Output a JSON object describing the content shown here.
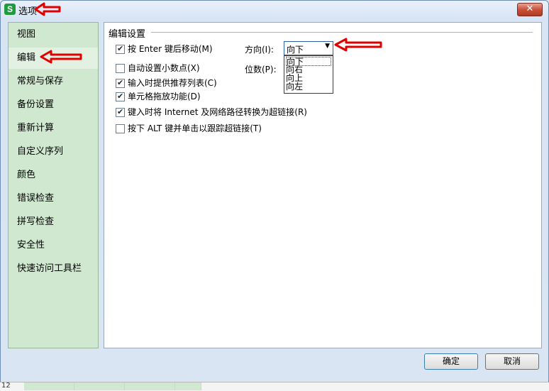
{
  "window": {
    "title": "选项",
    "app_icon_text": "S",
    "close_symbol": "✕"
  },
  "sidebar": {
    "items": [
      {
        "label": "视图"
      },
      {
        "label": "编辑"
      },
      {
        "label": "常规与保存"
      },
      {
        "label": "备份设置"
      },
      {
        "label": "重新计算"
      },
      {
        "label": "自定义序列"
      },
      {
        "label": "颜色"
      },
      {
        "label": "错误检查"
      },
      {
        "label": "拼写检查"
      },
      {
        "label": "安全性"
      },
      {
        "label": "快速访问工具栏"
      }
    ],
    "selected_index": 1
  },
  "edit": {
    "group_title": "编辑设置",
    "options": [
      {
        "label": "按 Enter 键后移动(M)",
        "checked": true
      },
      {
        "label": "自动设置小数点(X)",
        "checked": false
      },
      {
        "label": "输入时提供推荐列表(C)",
        "checked": true
      },
      {
        "label": "单元格拖放功能(D)",
        "checked": true
      },
      {
        "label": "键入时将 Internet 及网络路径转换为超链接(R)",
        "checked": true
      },
      {
        "label": "按下 ALT 键并单击以跟踪超链接(T)",
        "checked": false
      }
    ],
    "direction_label": "方向(I):",
    "direction_value": "向下",
    "direction_options": [
      "向下",
      "向右",
      "向上",
      "向左"
    ],
    "digits_label": "位数(P):"
  },
  "buttons": {
    "ok": "确定",
    "cancel": "取消"
  },
  "sheet": {
    "row_number": "12"
  },
  "colors": {
    "annotation_arrow": "#e00000",
    "sidebar_bg": "#cfe8cf",
    "app_icon": "#1f9b3e"
  }
}
